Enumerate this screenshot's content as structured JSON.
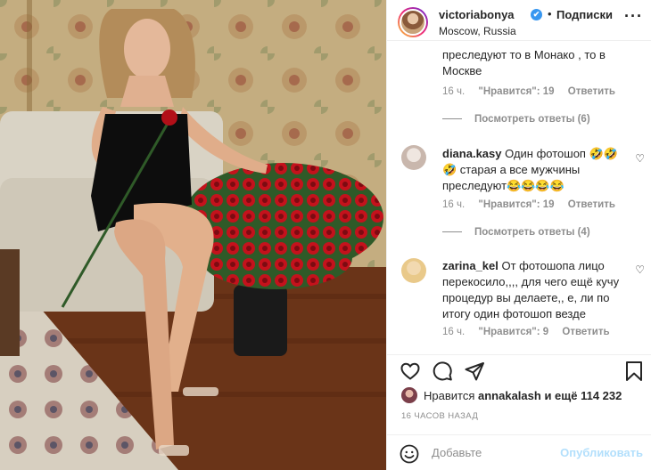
{
  "header": {
    "username": "victoriabonya",
    "verified_mark": "✔",
    "separator": "•",
    "follow_label": "Подписки",
    "location": "Moscow, Russia",
    "more_label": "···"
  },
  "comments": [
    {
      "id": "c0",
      "text_tail": "преследуют то в Монако , то в Москве",
      "time": "16 ч.",
      "likes": "\"Нравится\": 19",
      "reply": "Ответить",
      "view_replies": "Посмотреть ответы (6)"
    },
    {
      "id": "c1",
      "username": "diana.kasy",
      "text": "Один фотошоп 🤣🤣 🤣 старая а все мужчины преследуют😂😂😂😂",
      "time": "16 ч.",
      "likes": "\"Нравится\": 19",
      "reply": "Ответить",
      "view_replies": "Посмотреть ответы (4)"
    },
    {
      "id": "c2",
      "username": "zarina_kel",
      "text": "От фотошопа лицо перекосило,,,, для чего ещё кучу процедур вы делаете,, е, ли по итогу один фотошоп везде",
      "time": "16 ч.",
      "likes": "\"Нравится\": 9",
      "reply": "Ответить"
    }
  ],
  "likes": {
    "prefix": "Нравится",
    "user": "annakalash",
    "suffix": "и ещё 114 232"
  },
  "timestamp": "16 ЧАСОВ НАЗАД",
  "add_comment": {
    "placeholder": "Добавьте комментарий...",
    "visible_text": "Добавьте",
    "post_label": "Опубликовать"
  },
  "colors": {
    "accent": "#3897f0",
    "post_disabled": "#b2dffc",
    "muted": "#8e8e8e"
  }
}
